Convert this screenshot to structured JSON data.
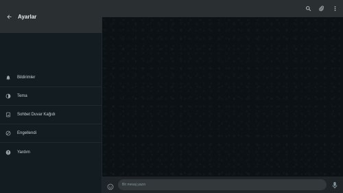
{
  "settings": {
    "title": "Ayarlar",
    "back_icon": "arrow-left-icon",
    "items": [
      {
        "label": "Bildirimler",
        "icon": "bell-icon"
      },
      {
        "label": "Tema",
        "icon": "theme-icon"
      },
      {
        "label": "Sohbet Duvar Kağıdı",
        "icon": "wallpaper-icon"
      },
      {
        "label": "Engellendi",
        "icon": "block-icon"
      },
      {
        "label": "Yardım",
        "icon": "help-icon"
      }
    ]
  },
  "chat_header": {
    "icons": [
      "search-icon",
      "paperclip-icon",
      "more-vertical-icon"
    ]
  },
  "composer": {
    "placeholder": "Bir mesaj yazın",
    "emoji_icon": "emoji-icon",
    "mic_icon": "microphone-icon"
  },
  "colors": {
    "panel_header": "#2a2f32",
    "sidebar_bg": "#131c21",
    "chat_bg": "#0b1115",
    "footer_bg": "#1e2428",
    "input_bg": "#33383b",
    "text": "#e9edef"
  }
}
